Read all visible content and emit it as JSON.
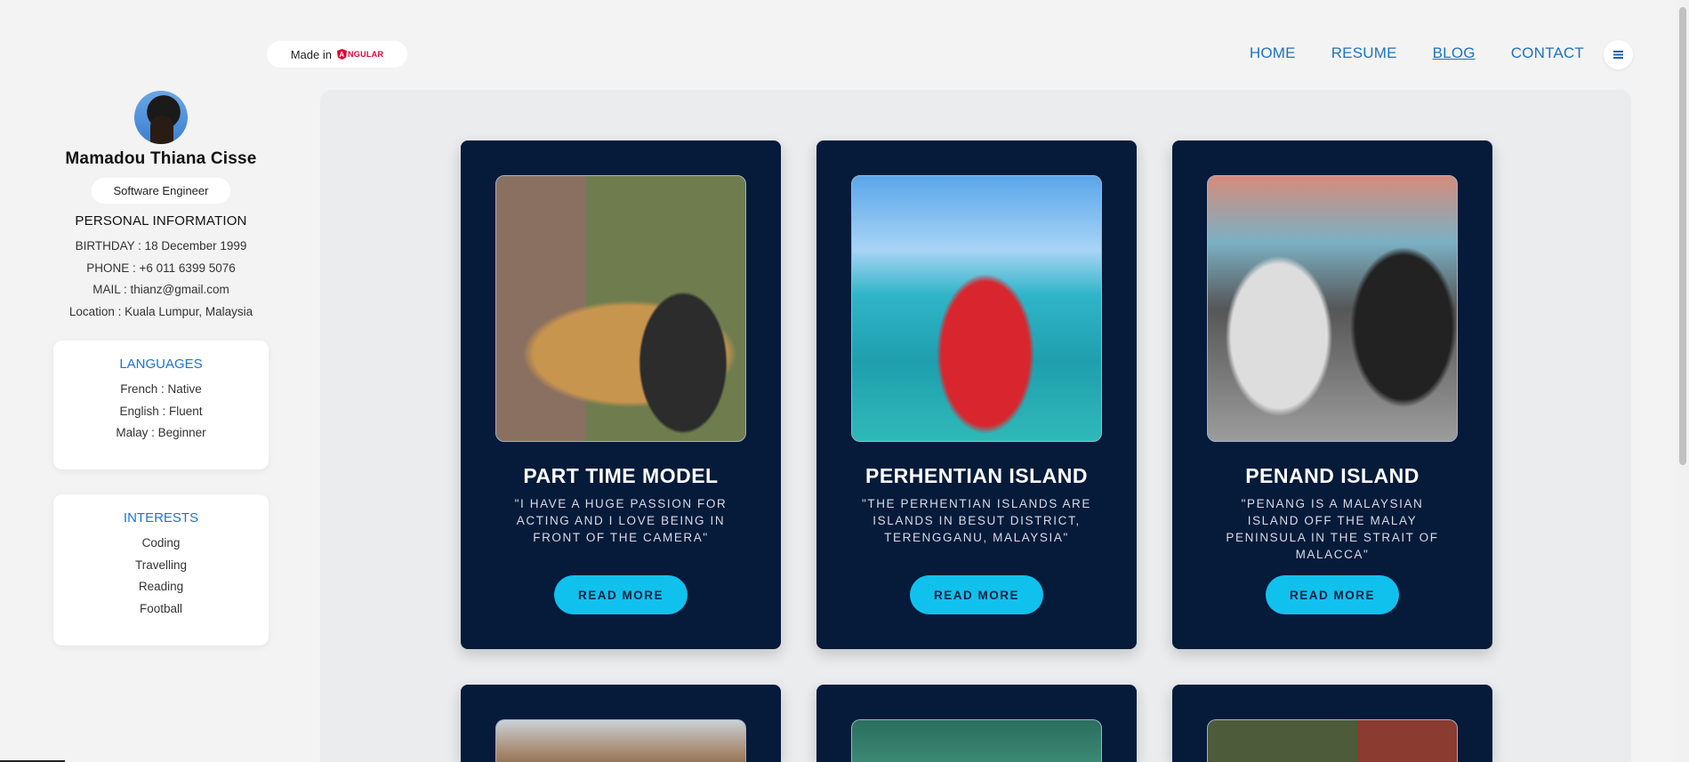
{
  "header": {
    "made_in_label": "Made in",
    "framework_logo_text": "NGULAR",
    "framework_logo_letter": "A",
    "nav": [
      {
        "label": "HOME",
        "active": false
      },
      {
        "label": "RESUME",
        "active": false
      },
      {
        "label": "BLOG",
        "active": true
      },
      {
        "label": "CONTACT",
        "active": false
      }
    ],
    "menu_icon": "hamburger-icon"
  },
  "profile": {
    "name": "Mamadou Thiana Cisse",
    "role": "Software Engineer",
    "personal_info_title": "PERSONAL INFORMATION",
    "personal_info": [
      "BIRTHDAY : 18 December 1999",
      "PHONE : +6 011 6399 5076",
      "MAIL : thianz@gmail.com",
      "Location : Kuala Lumpur, Malaysia"
    ],
    "languages_title": "LANGUAGES",
    "languages": [
      "French : Native",
      "English : Fluent",
      "Malay : Beginner"
    ],
    "interests_title": "INTERESTS",
    "interests": [
      "Coding",
      "Travelling",
      "Reading",
      "Football"
    ]
  },
  "blog": {
    "cards": [
      {
        "title": "PART TIME MODEL",
        "description": "\"I HAVE A HUGE PASSION FOR ACTING AND I LOVE BEING IN FRONT OF THE CAMERA\"",
        "button": "READ MORE"
      },
      {
        "title": "PERHENTIAN ISLAND",
        "description": "\"THE PERHENTIAN ISLANDS ARE ISLANDS IN BESUT DISTRICT, TERENGGANU, MALAYSIA\"",
        "button": "READ MORE"
      },
      {
        "title": "PENAND ISLAND",
        "description": "\"PENANG IS A MALAYSIAN ISLAND OFF THE MALAY PENINSULA IN THE STRAIT OF MALACCA\"",
        "button": "READ MORE"
      }
    ]
  },
  "colors": {
    "accent": "#1e73be",
    "card_bg": "#061a3a",
    "button_bg": "#10c1ee",
    "page_bg": "#f3f3f3"
  }
}
